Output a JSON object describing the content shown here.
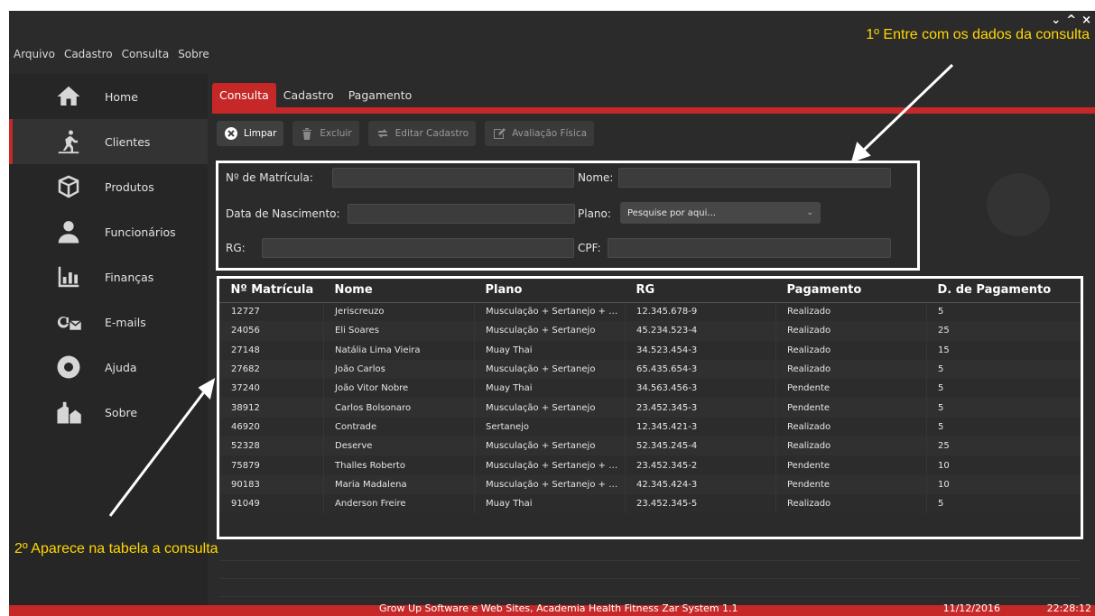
{
  "window": {
    "controls": [
      "⌄",
      "^",
      "×"
    ]
  },
  "menu": [
    "Arquivo",
    "Cadastro",
    "Consulta",
    "Sobre"
  ],
  "annotations": {
    "step1": "1º Entre com os dados da consulta",
    "step2": "2º Aparece na tabela a consulta"
  },
  "sidebar": {
    "items": [
      {
        "label": "Home",
        "icon": "home-icon"
      },
      {
        "label": "Clientes",
        "icon": "runner-icon",
        "active": true
      },
      {
        "label": "Produtos",
        "icon": "package-icon"
      },
      {
        "label": "Funcionários",
        "icon": "employee-icon"
      },
      {
        "label": "Finanças",
        "icon": "bar-chart-icon"
      },
      {
        "label": "E-mails",
        "icon": "email-icon"
      },
      {
        "label": "Ajuda",
        "icon": "lifebuoy-icon"
      },
      {
        "label": "Sobre",
        "icon": "buildings-icon"
      }
    ]
  },
  "tabs": [
    {
      "label": "Consulta",
      "active": true
    },
    {
      "label": "Cadastro"
    },
    {
      "label": "Pagamento"
    }
  ],
  "toolbar": {
    "limpar": "Limpar",
    "excluir": "Excluir",
    "editar": "Editar Cadastro",
    "avaliacao": "Avaliação Física"
  },
  "form": {
    "matricula_label": "Nº de Matrícula:",
    "nome_label": "Nome:",
    "nascimento_label": "Data de Nascimento:",
    "plano_label": "Plano:",
    "plano_placeholder": "Pesquise por aqui...",
    "rg_label": "RG:",
    "cpf_label": "CPF:"
  },
  "table": {
    "headers": [
      "Nº Matrícula",
      "Nome",
      "Plano",
      "RG",
      "Pagamento",
      "D. de Pagamento"
    ],
    "rows": [
      [
        "12727",
        "Jeriscreuzo",
        "Musculação + Sertanejo + Muay Thai",
        "12.345.678-9",
        "Realizado",
        "5"
      ],
      [
        "24056",
        "Eli Soares",
        "Musculação + Sertanejo",
        "45.234.523-4",
        "Realizado",
        "25"
      ],
      [
        "27148",
        "Natália Lima Vieira",
        "Muay Thai",
        "34.523.454-3",
        "Realizado",
        "15"
      ],
      [
        "27682",
        "João Carlos",
        "Musculação + Sertanejo",
        "65.435.654-3",
        "Realizado",
        "5"
      ],
      [
        "37240",
        "João Vitor Nobre",
        "Muay Thai",
        "34.563.456-3",
        "Pendente",
        "5"
      ],
      [
        "38912",
        "Carlos Bolsonaro",
        "Musculação + Sertanejo",
        "23.452.345-3",
        "Pendente",
        "5"
      ],
      [
        "46920",
        "Contrade",
        "Sertanejo",
        "12.345.421-3",
        "Realizado",
        "5"
      ],
      [
        "52328",
        "Deserve",
        "Musculação + Sertanejo",
        "52.345.245-4",
        "Realizado",
        "25"
      ],
      [
        "75879",
        "Thalles Roberto",
        "Musculação + Sertanejo + Muay Thai",
        "23.452.345-2",
        "Pendente",
        "10"
      ],
      [
        "90183",
        "Maria Madalena",
        "Musculação + Sertanejo + Muay Thai",
        "42.345.424-3",
        "Pendente",
        "10"
      ],
      [
        "91049",
        "Anderson Freire",
        "Muay Thai",
        "23.452.345-5",
        "Realizado",
        "5"
      ]
    ]
  },
  "footer": {
    "text": "Grow Up Software e Web Sites, Academia Health Fitness Zar System 1.1",
    "date": "11/12/2016",
    "time": "22:28:12"
  },
  "colors": {
    "accent": "#c62828",
    "background": "#2b2b2b",
    "annotation": "#ffd700"
  }
}
